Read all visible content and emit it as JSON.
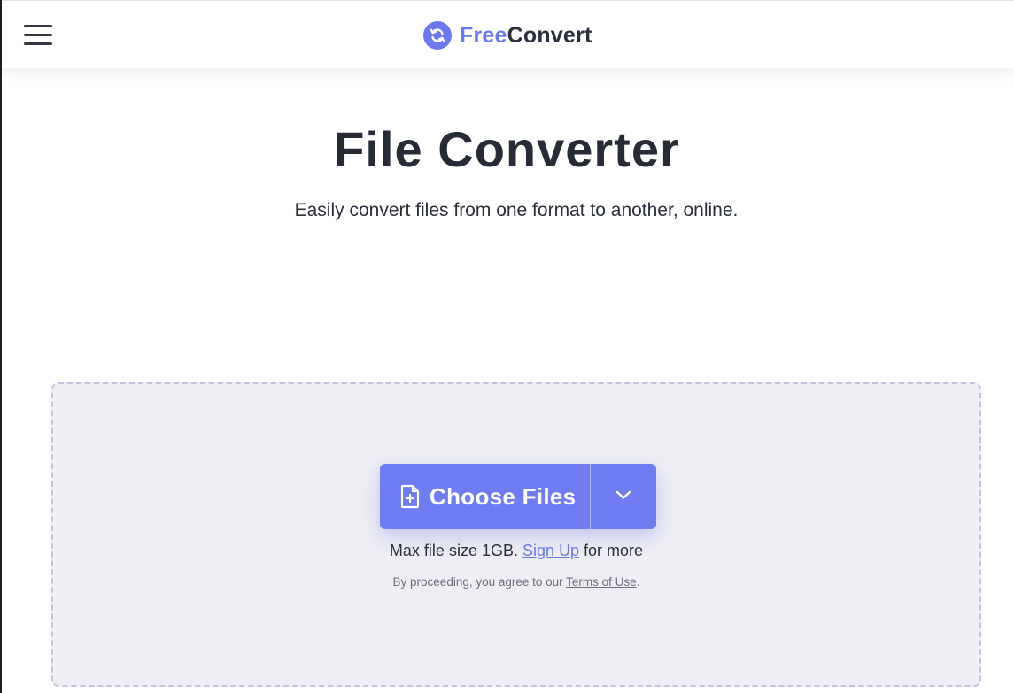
{
  "header": {
    "logo_free": "Free",
    "logo_convert": "Convert"
  },
  "hero": {
    "title": "File Converter",
    "subtitle": "Easily convert files from one format to another, online."
  },
  "upload": {
    "choose_files_label": "Choose Files",
    "max_size_prefix": "Max file size 1GB.",
    "signup_link": "Sign Up",
    "max_size_suffix": "for more",
    "terms_prefix": "By proceeding, you agree to our",
    "terms_link": "Terms of Use",
    "terms_suffix": "."
  },
  "icons": {
    "menu": "hamburger-menu-icon",
    "logo": "refresh-arrows-icon",
    "file": "file-plus-icon",
    "dropdown": "chevron-down-icon"
  },
  "colors": {
    "accent": "#6c78f0",
    "button": "#6f7cf2",
    "dropzone_bg": "#eeeef4",
    "dropzone_border": "#c3c4d9",
    "text_dark": "#262b36"
  }
}
